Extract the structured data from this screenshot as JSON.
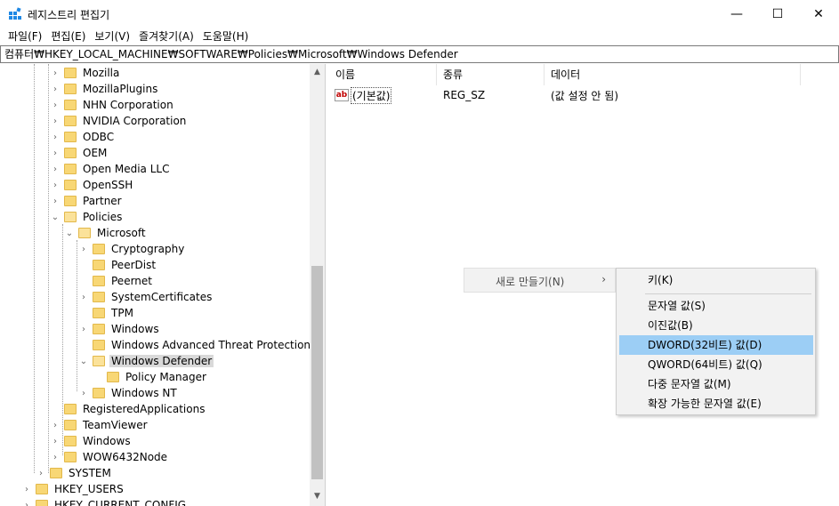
{
  "window": {
    "title": "레지스트리 편집기",
    "min": "—",
    "max": "☐",
    "close": "✕"
  },
  "menu": [
    "파일(F)",
    "편집(E)",
    "보기(V)",
    "즐겨찾기(A)",
    "도움말(H)"
  ],
  "address": "컴퓨터₩HKEY_LOCAL_MACHINE₩SOFTWARE₩Policies₩Microsoft₩Windows Defender",
  "tree": [
    {
      "label": "Mozilla",
      "chev": "›"
    },
    {
      "label": "MozillaPlugins",
      "chev": "›"
    },
    {
      "label": "NHN Corporation",
      "chev": "›"
    },
    {
      "label": "NVIDIA Corporation",
      "chev": "›"
    },
    {
      "label": "ODBC",
      "chev": "›"
    },
    {
      "label": "OEM",
      "chev": "›"
    },
    {
      "label": "Open Media LLC",
      "chev": "›"
    },
    {
      "label": "OpenSSH",
      "chev": "›"
    },
    {
      "label": "Partner",
      "chev": "›"
    },
    {
      "label": "Policies",
      "chev": "⌄"
    },
    {
      "label": "Microsoft",
      "chev": "⌄"
    },
    {
      "label": "Cryptography",
      "chev": "›"
    },
    {
      "label": "PeerDist",
      "chev": ""
    },
    {
      "label": "Peernet",
      "chev": ""
    },
    {
      "label": "SystemCertificates",
      "chev": "›"
    },
    {
      "label": "TPM",
      "chev": ""
    },
    {
      "label": "Windows",
      "chev": "›"
    },
    {
      "label": "Windows Advanced Threat Protection",
      "chev": ""
    },
    {
      "label": "Windows Defender",
      "chev": "⌄",
      "selected": true
    },
    {
      "label": "Policy Manager",
      "chev": ""
    },
    {
      "label": "Windows NT",
      "chev": "›"
    },
    {
      "label": "RegisteredApplications",
      "chev": ""
    },
    {
      "label": "TeamViewer",
      "chev": "›"
    },
    {
      "label": "Windows",
      "chev": "›"
    },
    {
      "label": "WOW6432Node",
      "chev": "›"
    },
    {
      "label": "SYSTEM",
      "chev": "›"
    },
    {
      "label": "HKEY_USERS",
      "chev": "›"
    },
    {
      "label": "HKEY_CURRENT_CONFIG",
      "chev": "›"
    }
  ],
  "columns": {
    "name": "이름",
    "type": "종류",
    "data": "데이터"
  },
  "values": [
    {
      "icon": "ab",
      "name": "(기본값)",
      "type": "REG_SZ",
      "data": "(값 설정 안 됨)"
    }
  ],
  "context_menu": {
    "new_label": "새로 만들기(N)",
    "arrow": "›"
  },
  "submenu": {
    "key": "키(K)",
    "items": [
      "문자열 값(S)",
      "이진값(B)",
      "DWORD(32비트) 값(D)",
      "QWORD(64비트) 값(Q)",
      "다중 문자열 값(M)",
      "확장 가능한 문자열 값(E)"
    ],
    "highlighted": "DWORD(32비트) 값(D)"
  },
  "scroll": {
    "up": "▲",
    "down": "▼"
  },
  "colors": {
    "highlight": "#9ccef5",
    "folder": "#f8d775",
    "selected_node": "#d9d9d9"
  }
}
